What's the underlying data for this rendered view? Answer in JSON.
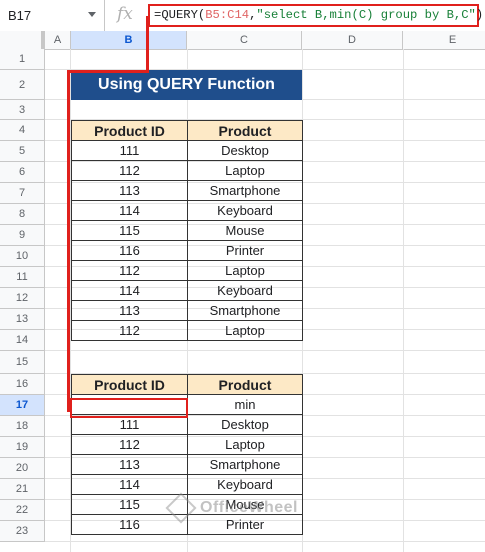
{
  "formula_bar": {
    "name_box": "B17",
    "fx_label": "fx",
    "formula_prefix": "=QUERY(",
    "formula_range": "B5:C14",
    "formula_sep": ",",
    "formula_string": "\"select B,min(C) group by B,C\"",
    "formula_suffix": ")"
  },
  "columns": [
    "A",
    "B",
    "C",
    "D",
    "E"
  ],
  "rows": [
    "1",
    "2",
    "3",
    "4",
    "5",
    "6",
    "7",
    "8",
    "9",
    "10",
    "11",
    "12",
    "13",
    "14",
    "15",
    "16",
    "17",
    "18",
    "19",
    "20",
    "21",
    "22",
    "23"
  ],
  "title": "Using QUERY Function",
  "table1": {
    "headers": [
      "Product ID",
      "Product"
    ],
    "rows": [
      [
        "111",
        "Desktop"
      ],
      [
        "112",
        "Laptop"
      ],
      [
        "113",
        "Smartphone"
      ],
      [
        "114",
        "Keyboard"
      ],
      [
        "115",
        "Mouse"
      ],
      [
        "116",
        "Printer"
      ],
      [
        "112",
        "Laptop"
      ],
      [
        "114",
        "Keyboard"
      ],
      [
        "113",
        "Smartphone"
      ],
      [
        "112",
        "Laptop"
      ]
    ]
  },
  "table2": {
    "headers": [
      "Product ID",
      "Product"
    ],
    "rows": [
      [
        "",
        "min"
      ],
      [
        "111",
        "Desktop"
      ],
      [
        "112",
        "Laptop"
      ],
      [
        "113",
        "Smartphone"
      ],
      [
        "114",
        "Keyboard"
      ],
      [
        "115",
        "Mouse"
      ],
      [
        "116",
        "Printer"
      ]
    ]
  },
  "watermark": "OfficeWheel",
  "colors": {
    "title_bg": "#1f4e8c",
    "header_bg": "#fde9c6",
    "highlight": "#e0201c"
  }
}
